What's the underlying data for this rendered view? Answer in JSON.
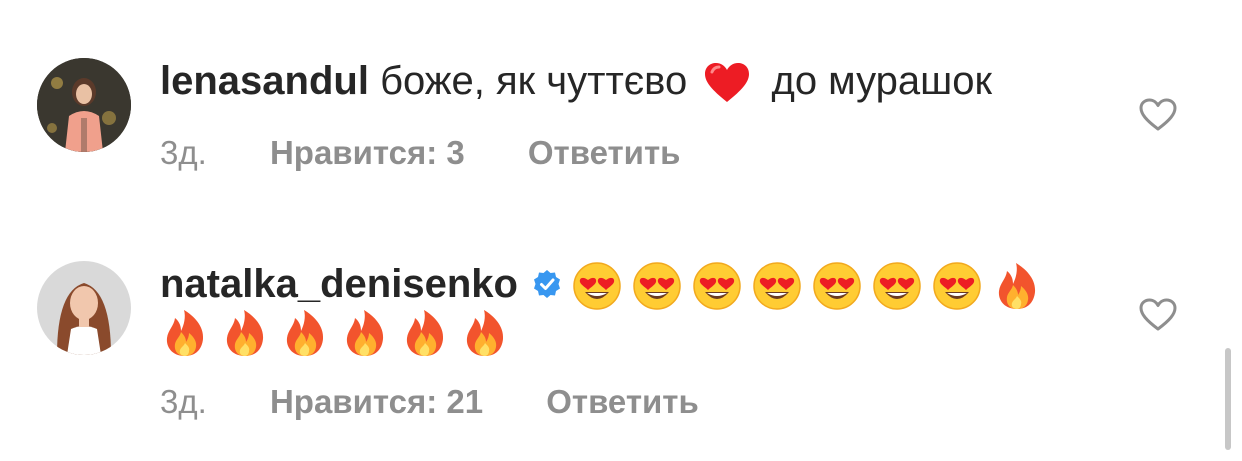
{
  "comments": [
    {
      "username": "lenasandul",
      "text_before": "боже, як чуттєво",
      "emoji_inline": "red-heart",
      "text_after": "до мурашок",
      "time": "3д.",
      "likes": "Нравится: 3",
      "reply": "Ответить"
    },
    {
      "username": "natalka_denisenko",
      "verified": true,
      "emoji_line1": [
        "heart-eyes",
        "heart-eyes",
        "heart-eyes",
        "heart-eyes",
        "heart-eyes",
        "heart-eyes",
        "heart-eyes",
        "fire"
      ],
      "emoji_line2": [
        "fire",
        "fire",
        "fire",
        "fire",
        "fire",
        "fire"
      ],
      "time": "3д.",
      "likes": "Нравится: 21",
      "reply": "Ответить"
    }
  ],
  "icons": {
    "like": "heart-outline-icon",
    "verified": "verified-badge-icon"
  },
  "colors": {
    "text": "#262626",
    "meta": "#8e8e8e",
    "verified": "#3897f0",
    "heart": "#ed1c24"
  }
}
